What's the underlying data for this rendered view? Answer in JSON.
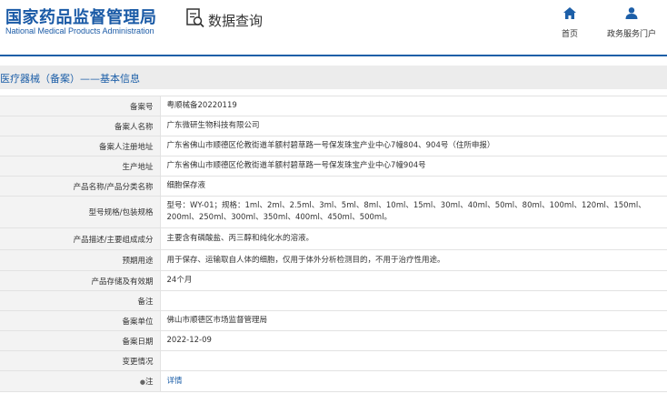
{
  "header": {
    "logo_cn": "国家药品监督管理局",
    "logo_en": "National Medical Products Administration",
    "app_title": "数据查询",
    "nav": [
      {
        "label": "首页",
        "icon": "home-icon"
      },
      {
        "label": "政务服务门户",
        "icon": "user-icon"
      }
    ]
  },
  "breadcrumb": "医疗器械（备案）——基本信息",
  "rows": [
    {
      "key": "备案号",
      "value": "粤顺械备20220119"
    },
    {
      "key": "备案人名称",
      "value": "广东微研生物科技有限公司"
    },
    {
      "key": "备案人注册地址",
      "value": "广东省佛山市顺德区伦教街道羊额村碧草路一号保发珠宝产业中心7幢804、904号（住所申报）"
    },
    {
      "key": "生产地址",
      "value": "广东省佛山市顺德区伦教街道羊额村碧草路一号保发珠宝产业中心7幢904号"
    },
    {
      "key": "产品名称/产品分类名称",
      "value": "细胞保存液"
    },
    {
      "key": "型号规格/包装规格",
      "value": "型号：WY-01；规格：1ml、2ml、2.5ml、3ml、5ml、8ml、10ml、15ml、30ml、40ml、50ml、80ml、100ml、120ml、150ml、200ml、250ml、300ml、350ml、400ml、450ml、500ml。"
    },
    {
      "key": "产品描述/主要组成成分",
      "value": "主要含有磷酸盐、丙三醇和纯化水的溶液。"
    },
    {
      "key": "预期用途",
      "value": "用于保存、运输取自人体的细胞，仅用于体外分析检测目的，不用于治疗性用途。"
    },
    {
      "key": "产品存储及有效期",
      "value": "24个月"
    },
    {
      "key": "备注",
      "value": ""
    },
    {
      "key": "备案单位",
      "value": "佛山市顺德区市场监督管理局"
    },
    {
      "key": "备案日期",
      "value": "2022-12-09"
    },
    {
      "key": "变更情况",
      "value": ""
    }
  ],
  "note_row": {
    "key": "注",
    "link": "详情"
  },
  "colors": {
    "brand": "#1a5aa6",
    "link": "#1d5fa8",
    "key_bg": "#f3f3f3",
    "crumb_bg": "#ececec"
  }
}
